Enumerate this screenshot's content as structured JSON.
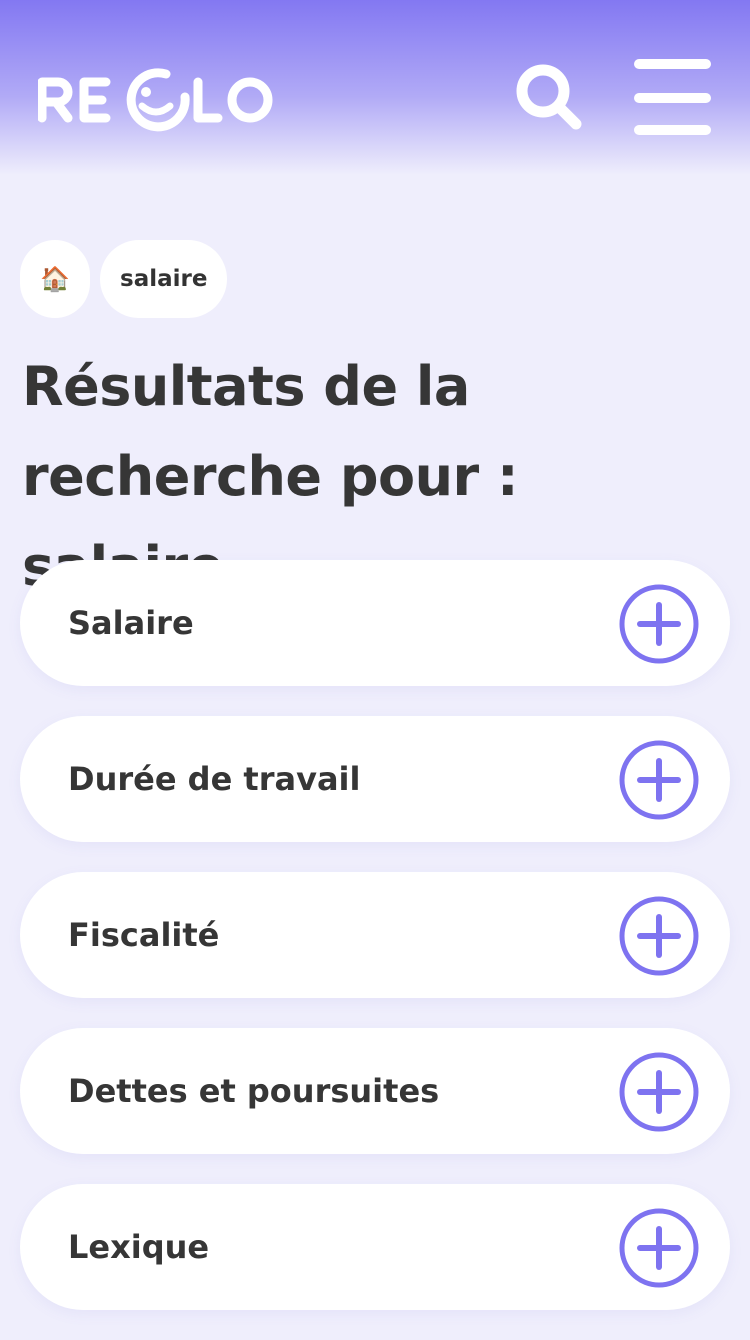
{
  "header": {
    "logo_text": "REGLO",
    "search_icon": "search-icon",
    "menu_icon": "hamburger-menu-icon"
  },
  "breadcrumb": {
    "home_icon": "house-emoji-icon",
    "home_glyph": "🏠",
    "current": "salaire"
  },
  "page": {
    "title": "Résultats de la recherche pour : salaire"
  },
  "results": [
    {
      "label": "Salaire"
    },
    {
      "label": "Durée de travail"
    },
    {
      "label": "Fiscalité"
    },
    {
      "label": "Dettes et poursuites"
    },
    {
      "label": "Lexique"
    }
  ],
  "colors": {
    "accent": "#7e73f0",
    "background": "#efeefc",
    "text": "#363636",
    "card": "#ffffff"
  }
}
